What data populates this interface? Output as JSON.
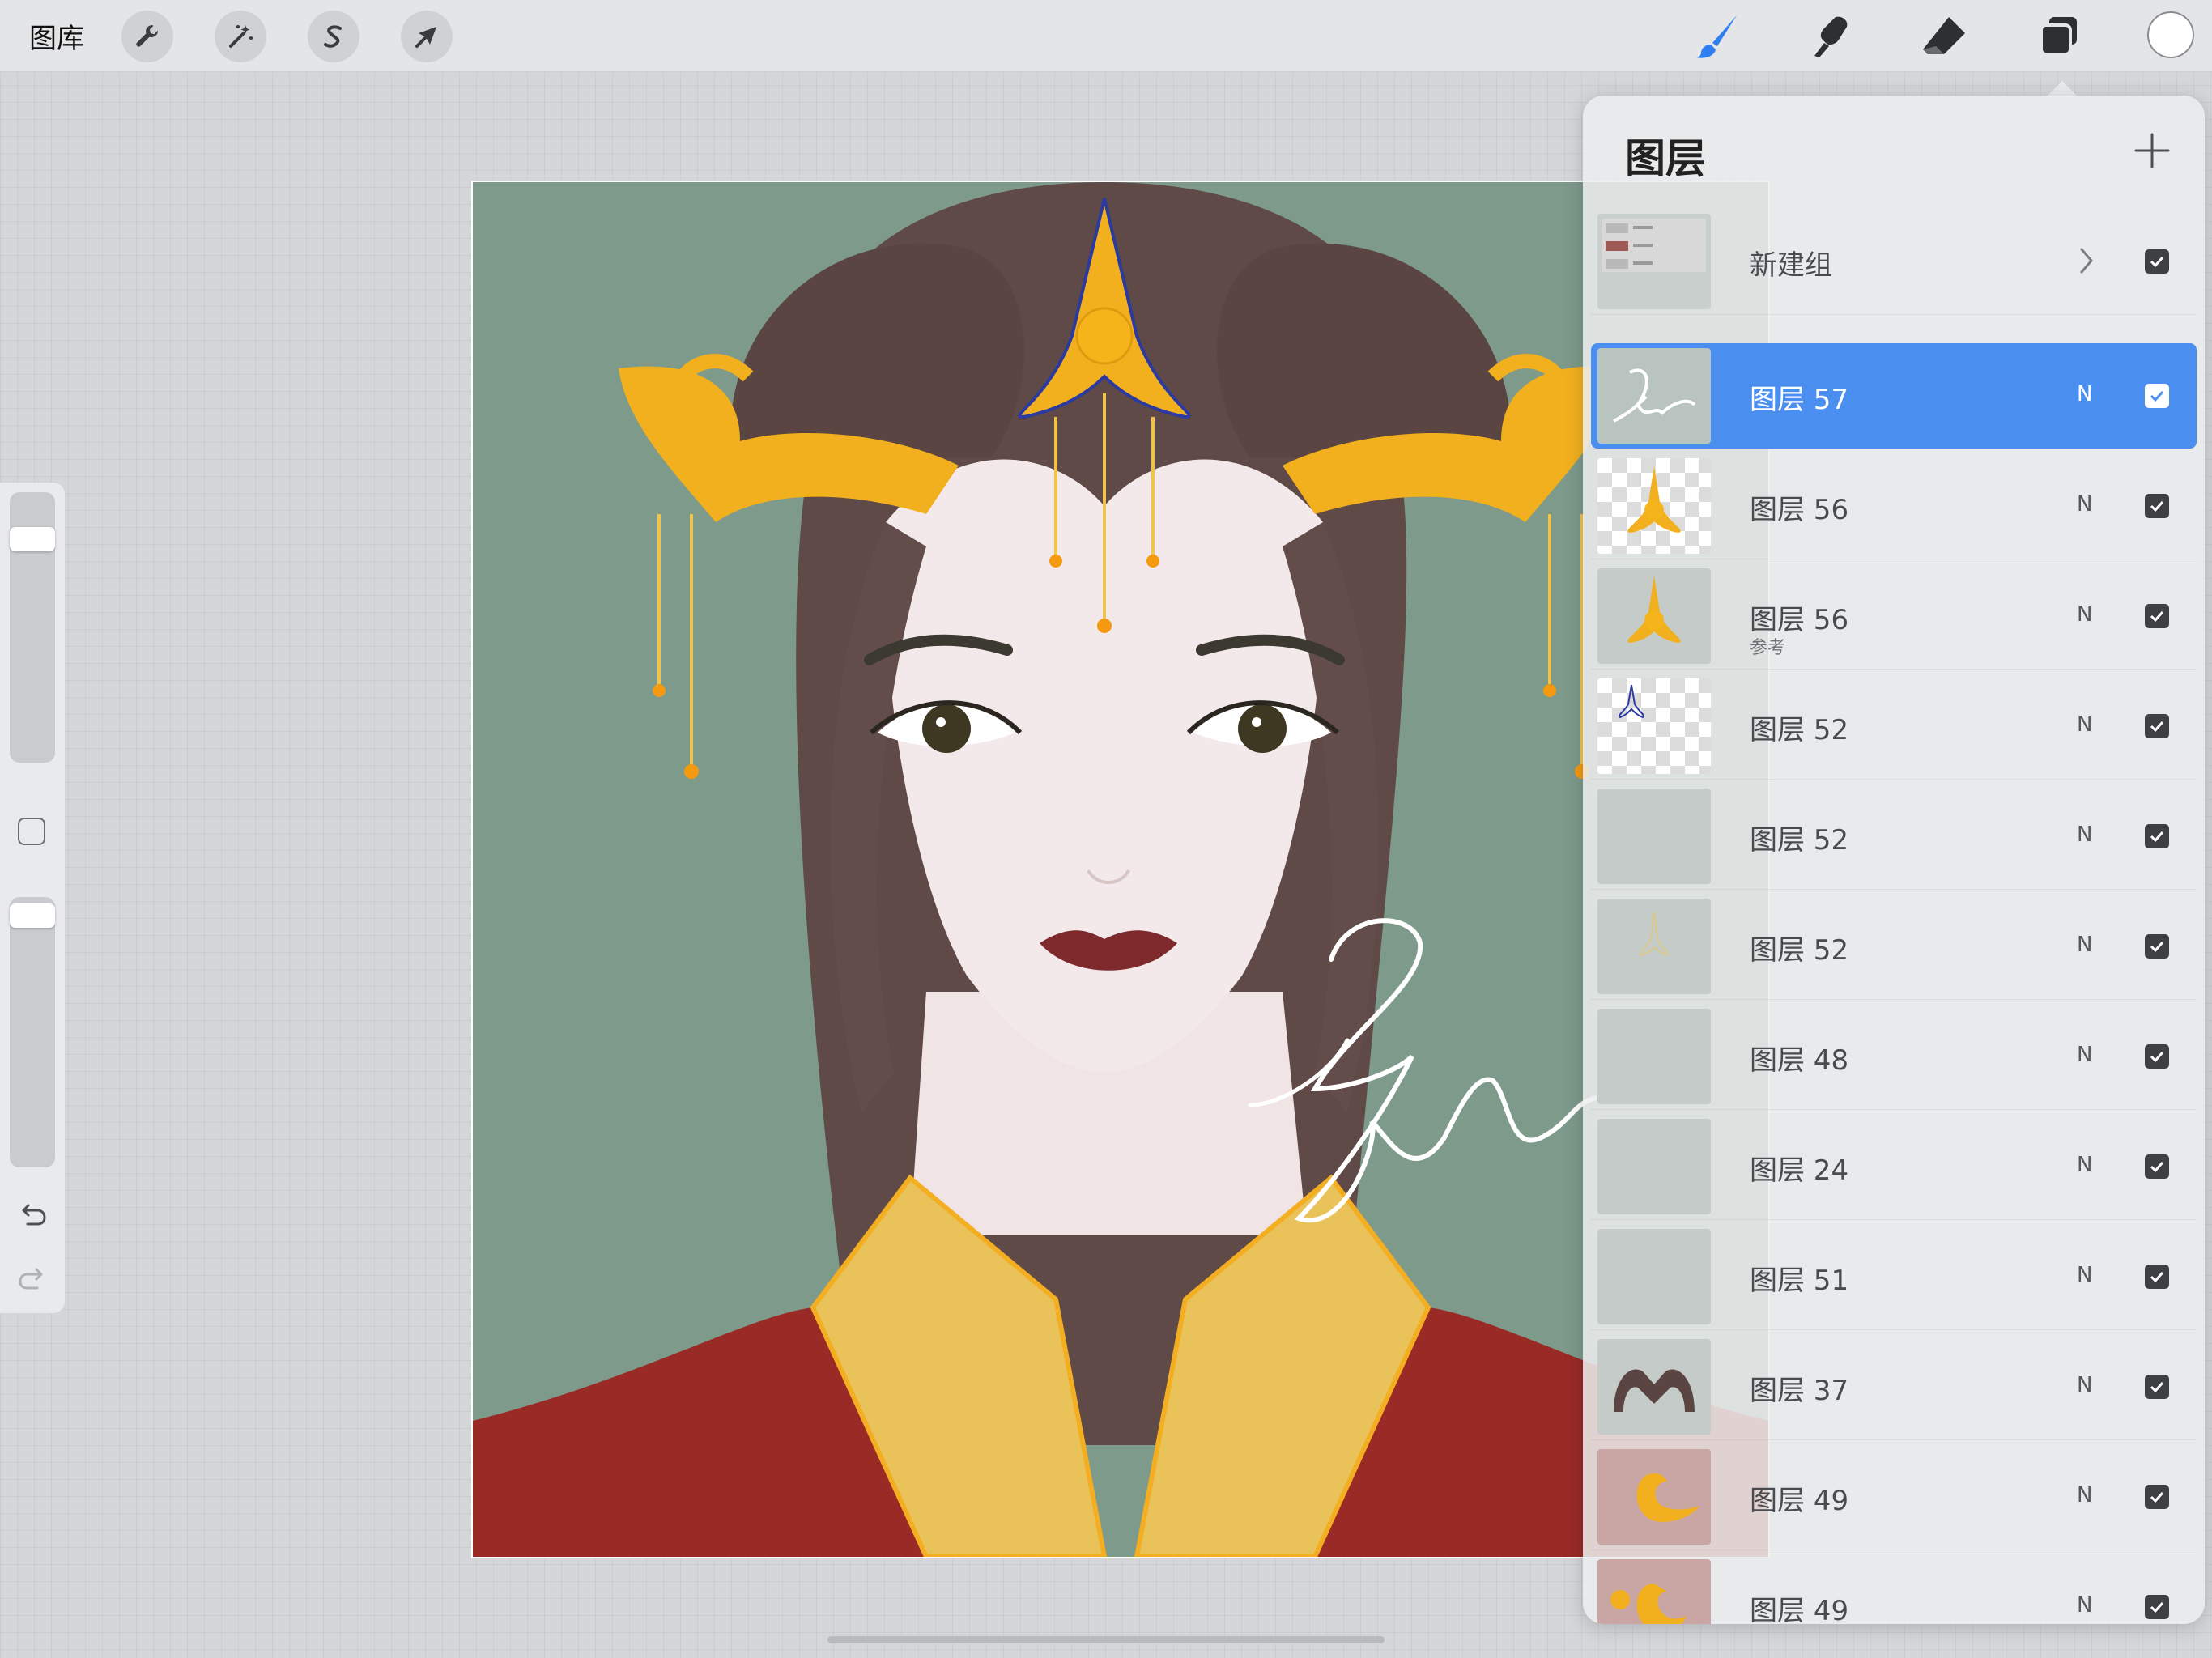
{
  "toolbar": {
    "gallery_label": "图库",
    "left_tools": [
      {
        "name": "actions",
        "icon": "wrench-icon"
      },
      {
        "name": "adjustments",
        "icon": "magic-wand-icon"
      },
      {
        "name": "selection",
        "icon": "selection-s-icon"
      },
      {
        "name": "transform",
        "icon": "arrow-cursor-icon"
      }
    ],
    "right_tools": [
      {
        "name": "brush",
        "icon": "brush-icon",
        "active": true
      },
      {
        "name": "smudge",
        "icon": "smudge-icon",
        "active": false
      },
      {
        "name": "eraser",
        "icon": "eraser-icon",
        "active": false
      },
      {
        "name": "layers",
        "icon": "layers-icon",
        "active": false
      }
    ],
    "accent_color": "#2f7ff0",
    "current_color": "#ffffff"
  },
  "sidebar": {
    "brush_size_level": 0.08,
    "opacity_level": 0.0,
    "icons": [
      "modify-square-icon",
      "undo-icon",
      "redo-icon"
    ]
  },
  "layers_panel": {
    "title": "图层",
    "add_icon": "plus-icon",
    "layers": [
      {
        "name": "新建组",
        "is_group": true,
        "visible": true,
        "thumb": "group"
      },
      {
        "name": "图层 57",
        "blend": "N",
        "visible": true,
        "selected": true,
        "thumb": "signature"
      },
      {
        "name": "图层 56",
        "blend": "N",
        "visible": true,
        "thumb": "crown-checker"
      },
      {
        "name": "图层 56",
        "blend": "N",
        "visible": true,
        "sub": "参考",
        "thumb": "crown-solid"
      },
      {
        "name": "图层 52",
        "blend": "N",
        "visible": true,
        "thumb": "outline-checker"
      },
      {
        "name": "图层 52",
        "blend": "N",
        "visible": true,
        "thumb": "plain"
      },
      {
        "name": "图层 52",
        "blend": "N",
        "visible": true,
        "thumb": "faint-crown"
      },
      {
        "name": "图层 48",
        "blend": "N",
        "visible": true,
        "thumb": "plain"
      },
      {
        "name": "图层 24",
        "blend": "N",
        "visible": true,
        "thumb": "plain"
      },
      {
        "name": "图层 51",
        "blend": "N",
        "visible": true,
        "thumb": "plain"
      },
      {
        "name": "图层 37",
        "blend": "N",
        "visible": true,
        "thumb": "hair"
      },
      {
        "name": "图层 49",
        "blend": "N",
        "visible": true,
        "thumb": "gold-swirl"
      },
      {
        "name": "图层 49",
        "blend": "N",
        "visible": true,
        "thumb": "gold-swirl-2"
      }
    ]
  },
  "canvas": {
    "background_color": "#7d9a8b",
    "hair_color": "#5f4a47",
    "gold_color": "#f2b01e",
    "robe_color": "#9a2a26",
    "collar_color": "#e9c25a",
    "skin_color": "#f3e9ea"
  }
}
